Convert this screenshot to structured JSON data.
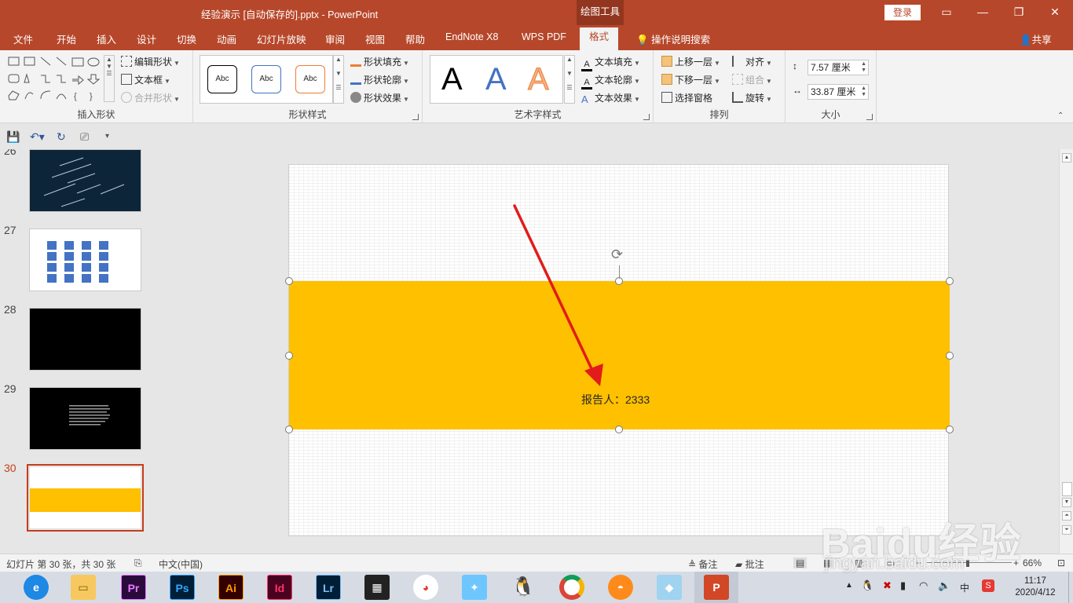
{
  "window": {
    "title": "经验演示 [自动保存的].pptx  -  PowerPoint",
    "context_tab_header": "绘图工具",
    "login_label": "登录"
  },
  "tabs": [
    "文件",
    "开始",
    "插入",
    "设计",
    "切换",
    "动画",
    "幻灯片放映",
    "审阅",
    "视图",
    "帮助",
    "EndNote X8",
    "WPS PDF",
    "格式"
  ],
  "active_tab": "格式",
  "tell_me": "操作说明搜索",
  "share_label": "共享",
  "ribbon": {
    "insert_shapes": {
      "label": "插入形状",
      "edit_shape": "编辑形状",
      "text_box": "文本框",
      "merge_shapes": "合并形状"
    },
    "shape_styles": {
      "label": "形状样式",
      "presets": [
        "Abc",
        "Abc",
        "Abc"
      ],
      "fill": "形状填充",
      "outline": "形状轮廓",
      "effects": "形状效果"
    },
    "wordart_styles": {
      "label": "艺术字样式",
      "presets": [
        "A",
        "A",
        "A"
      ],
      "text_fill": "文本填充",
      "text_outline": "文本轮廓",
      "text_effects": "文本效果"
    },
    "arrange": {
      "label": "排列",
      "bring_forward": "上移一层",
      "send_backward": "下移一层",
      "selection_pane": "选择窗格",
      "align": "对齐",
      "group": "组合",
      "rotate": "旋转"
    },
    "size": {
      "label": "大小",
      "height": "7.57 厘米",
      "width": "33.87 厘米"
    }
  },
  "thumbnails": [
    {
      "number": "26",
      "theme": "dark-streaks"
    },
    {
      "number": "27",
      "theme": "blue-grid"
    },
    {
      "number": "28",
      "theme": "black"
    },
    {
      "number": "29",
      "theme": "black-text"
    },
    {
      "number": "30",
      "theme": "yellow-banner",
      "selected": true
    }
  ],
  "slide": {
    "banner_color": "#ffc000",
    "reporter_text": "报告人：2333",
    "arrow_color": "#e31b1b"
  },
  "statusbar": {
    "slide_info": "幻灯片 第 30 张，共 30 张",
    "language": "中文(中国)",
    "notes": "备注",
    "comments": "批注",
    "zoom": "66%"
  },
  "taskbar": {
    "apps": [
      "Edge",
      "Explorer",
      "Pr",
      "Ps",
      "Ai",
      "Id",
      "Lr",
      "Video",
      "Color",
      "Bird",
      "QQ",
      "Chrome",
      "Orange",
      "Blue",
      "PowerPoint"
    ],
    "time": "11:17",
    "date": "2020/4/12",
    "ime": "中"
  },
  "watermark": {
    "brand": "Baidu经验",
    "url": "jingyan.baidu.com"
  },
  "colors": {
    "accent": "#b7472a",
    "banner": "#ffc000",
    "selection": "#c43e1c"
  }
}
